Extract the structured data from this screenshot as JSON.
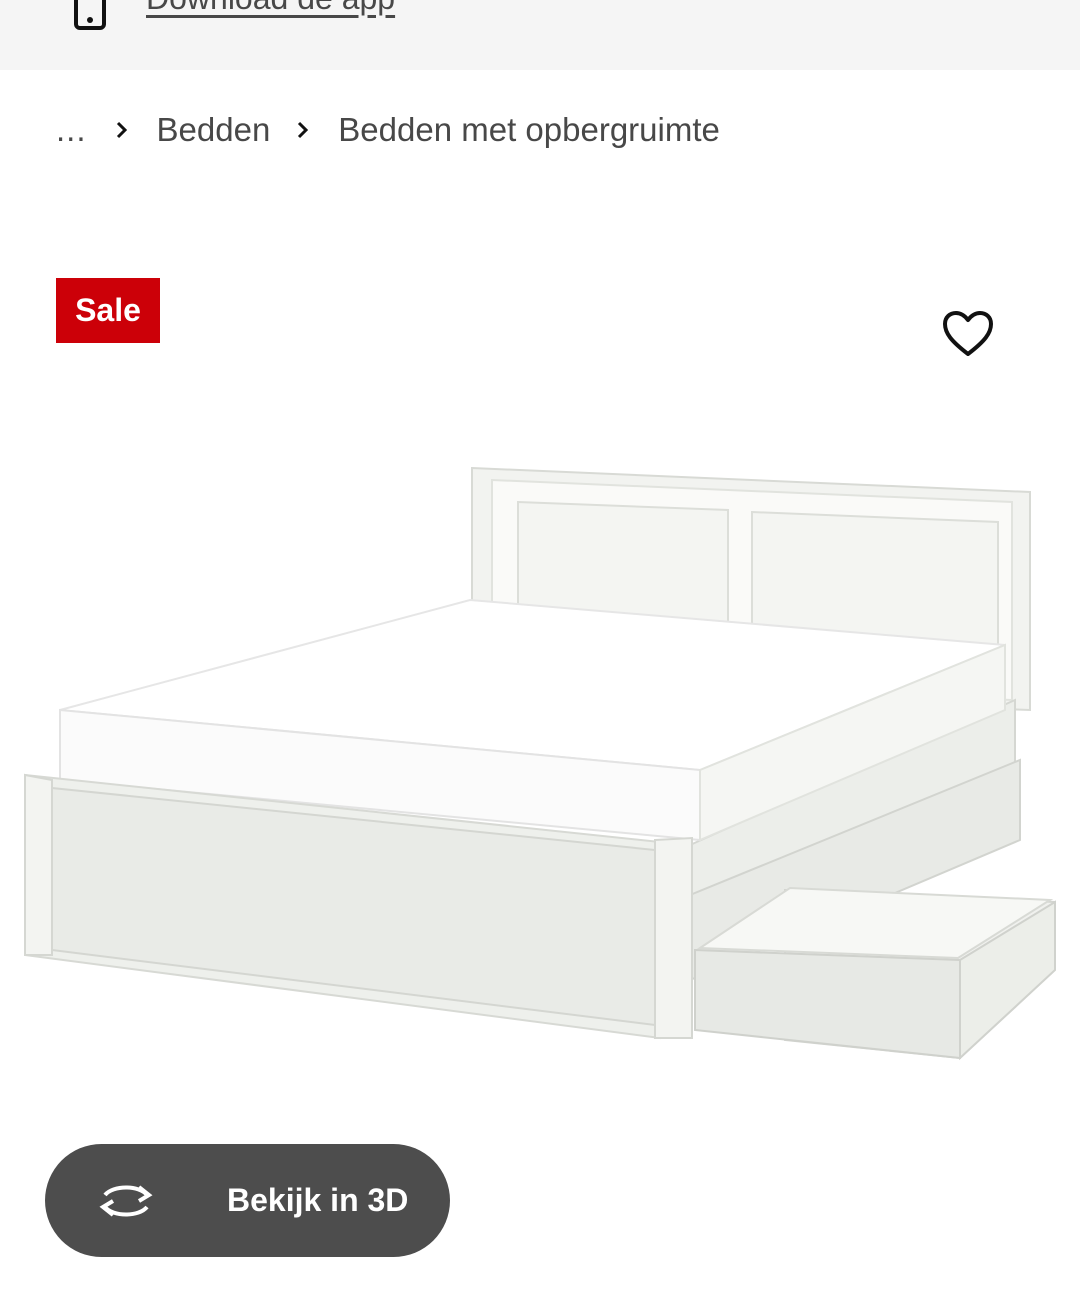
{
  "banner": {
    "link_label": "Download de app",
    "icon": "phone-icon"
  },
  "breadcrumb": {
    "ellipsis": "...",
    "items": [
      "Bedden",
      "Bedden met opbergruimte"
    ]
  },
  "product": {
    "badge": "Sale",
    "badge_color": "#cc0008",
    "favorite_icon": "heart-icon",
    "image_alt": "bed-with-storage-drawers"
  },
  "view3d": {
    "label": "Bekijk in 3D",
    "icon": "rotate-3d-icon",
    "button_color": "#4d4d4d"
  }
}
